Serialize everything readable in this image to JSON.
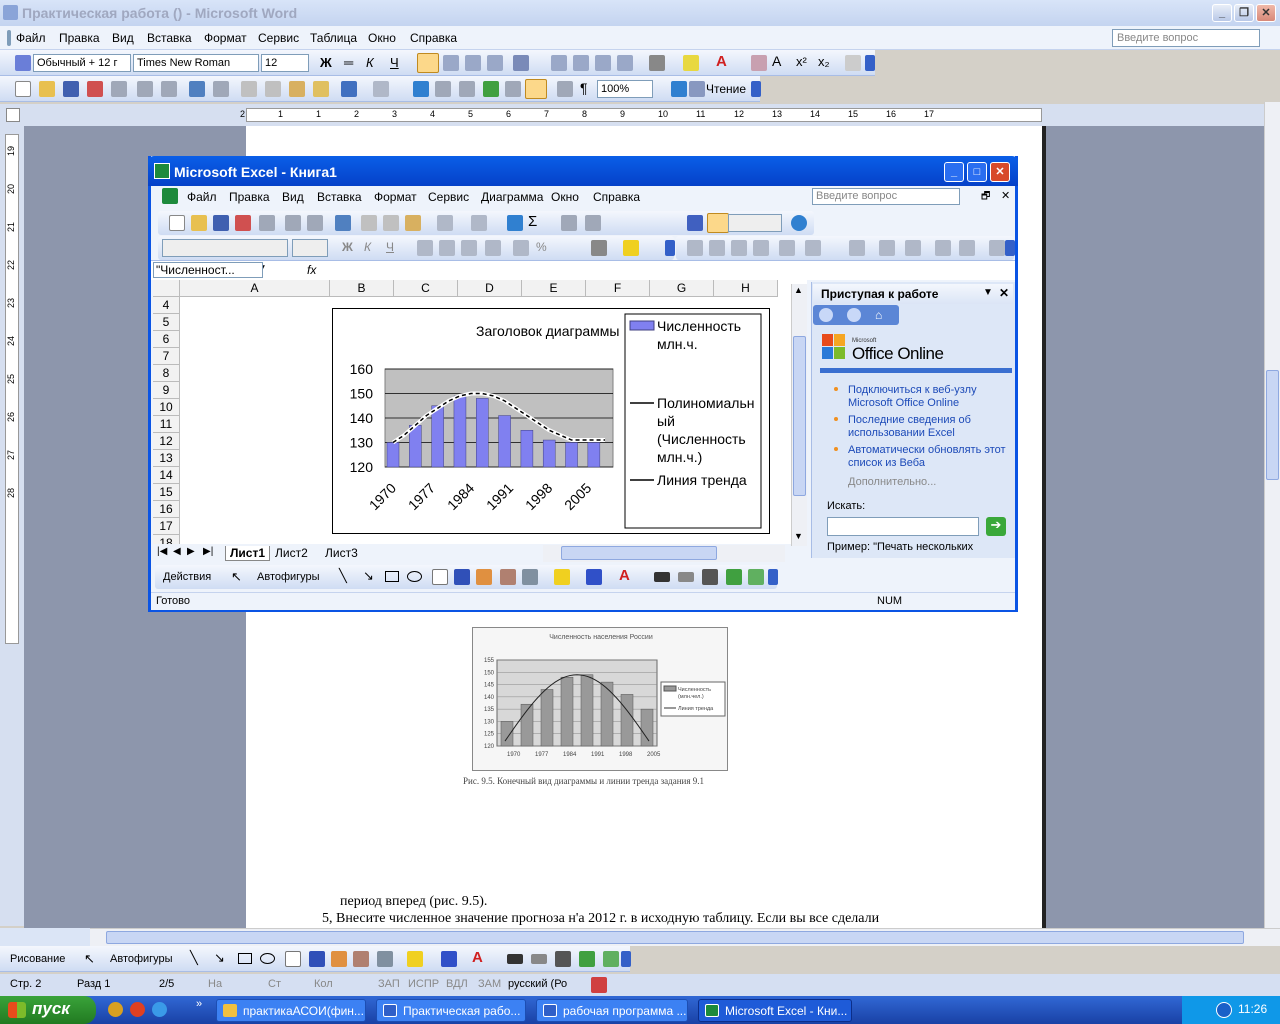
{
  "word": {
    "title": "Практическая работа () - Microsoft Word",
    "menu": [
      "Файл",
      "Правка",
      "Вид",
      "Вставка",
      "Формат",
      "Сервис",
      "Таблица",
      "Окно",
      "Справка"
    ],
    "help_placeholder": "Введите вопрос",
    "style_combo": "Обычный + 12 г",
    "font_combo": "Times New Roman",
    "size_combo": "12",
    "zoom_combo": "100%",
    "reading_label": "Чтение",
    "ruler_numbers": [
      "2",
      "1",
      "1",
      "2",
      "3",
      "4",
      "5",
      "6",
      "7",
      "8",
      "9",
      "10",
      "11",
      "12",
      "13",
      "14",
      "15",
      "16",
      "17"
    ],
    "vruler_numbers": [
      "19",
      "20",
      "21",
      "22",
      "23",
      "24",
      "25",
      "26",
      "27",
      "28"
    ],
    "doc_text_line1": "период вперед (рис. 9.5).",
    "doc_text_line2": "5, Внесите численное значение прогноза н'а 2012 г. в исходную таблицу. Если вы все сделали",
    "figure_caption": "Рис. 9.5. Конечный вид диаграммы и линии тренда  задания 9.1",
    "figure_title": "Численность населения России",
    "draw_toolbar": {
      "draw_label": "Рисование",
      "autoshapes_label": "Автофигуры"
    },
    "status": {
      "page": "Стр. 2",
      "section": "Разд 1",
      "pages": "2/5",
      "at": "На",
      "ln": "Ст",
      "col": "Кол",
      "rec": "ЗАП",
      "trk": "ИСПР",
      "ext": "ВДЛ",
      "ovr": "ЗАМ",
      "lang": "русский (Ро"
    }
  },
  "excel": {
    "title": "Microsoft Excel - Книга1",
    "menu": [
      "Файл",
      "Правка",
      "Вид",
      "Вставка",
      "Формат",
      "Сервис",
      "Диаграмма",
      "Окно",
      "Справка"
    ],
    "help_placeholder": "Введите вопрос",
    "name_box": "\"Численност...",
    "fx_label": "fx",
    "columns": [
      "A",
      "B",
      "C",
      "D",
      "E",
      "F",
      "G",
      "H"
    ],
    "rows": [
      "4",
      "5",
      "6",
      "7",
      "8",
      "9",
      "10",
      "11",
      "12",
      "13",
      "14",
      "15",
      "16",
      "17",
      "18"
    ],
    "sheet_tabs": [
      "Лист1",
      "Лист2",
      "Лист3"
    ],
    "draw_actions_label": "Действия",
    "draw_autoshapes_label": "Автофигуры",
    "status_ready": "Готово",
    "status_num": "NUM",
    "taskpane": {
      "title": "Приступая к работе",
      "office_small": "Microsoft",
      "office_brand": "Office Online",
      "links": [
        "Подключиться к веб-узлу Microsoft Office Online",
        "Последние сведения об использовании Excel",
        "Автоматически обновлять этот список из Веба"
      ],
      "more_label": "Дополнительно...",
      "search_label": "Искать:",
      "example_text": "Пример: \"Печать нескольких"
    }
  },
  "taskbar": {
    "start_label": "пуск",
    "tasks": [
      "практикаАСОИ(фин...",
      "Практическая рабо...",
      "рабочая программа ...",
      "Microsoft Excel - Кни..."
    ],
    "lang": "RU",
    "clock": "11:26"
  },
  "chart_data": [
    {
      "type": "bar",
      "title": "Заголовок диаграммы",
      "categories": [
        "1970",
        "1977",
        "1984",
        "1991",
        "1998",
        "2005"
      ],
      "x": [
        1970,
        1972,
        1974,
        1976,
        1978,
        1980,
        1982,
        1984,
        1986,
        1988,
        1990,
        1992,
        1994,
        1996,
        1998,
        2000,
        2002,
        2004,
        2006,
        2008
      ],
      "series": [
        {
          "name": "Численность млн.ч.",
          "values": [
            130,
            131,
            137,
            141,
            145,
            147,
            149,
            150,
            148,
            145,
            141,
            138,
            135,
            132,
            131,
            131,
            130,
            131,
            130,
            131
          ],
          "color": "#8080f0"
        },
        {
          "name": "Полиномиальный (Численность млн.ч.)",
          "type": "line",
          "values": [
            130,
            133,
            137,
            141,
            144,
            147,
            149,
            150,
            150,
            149,
            147,
            144,
            141,
            138,
            135,
            133,
            131,
            131,
            131,
            131
          ]
        },
        {
          "name": "Линия тренда",
          "type": "line"
        }
      ],
      "ylim": [
        120,
        160
      ],
      "yticks": [
        120,
        130,
        140,
        150,
        160
      ],
      "grid": true,
      "legend": "right"
    },
    {
      "type": "bar",
      "title": "Численность населения России",
      "categories": [
        "1970",
        "1977",
        "1984",
        "1991",
        "1998",
        "2005"
      ],
      "series": [
        {
          "name": "Численность (млн.чел.)",
          "values": [
            130,
            137,
            143,
            148,
            149,
            146,
            141,
            135
          ]
        },
        {
          "name": "Линия тренда",
          "type": "line"
        }
      ],
      "ylim": [
        120,
        155
      ],
      "yticks": [
        120,
        125,
        130,
        135,
        140,
        145,
        150,
        155
      ],
      "legend": "right"
    }
  ]
}
